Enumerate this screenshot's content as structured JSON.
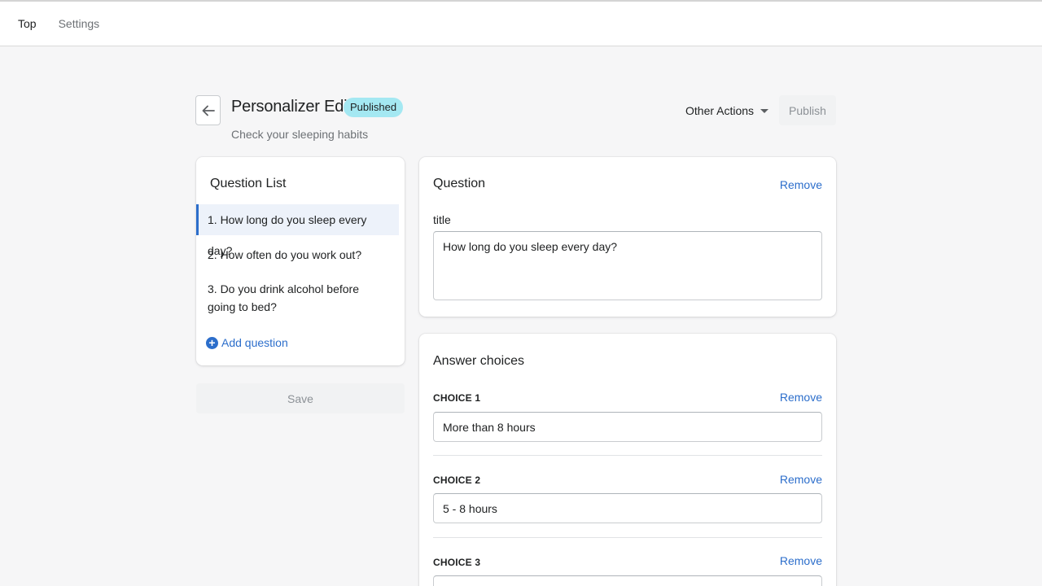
{
  "nav": {
    "items": [
      {
        "label": "Top"
      },
      {
        "label": "Settings"
      }
    ]
  },
  "header": {
    "title": "Personalizer Edit",
    "badge": "Published",
    "subtitle": "Check your sleeping habits",
    "other_actions_label": "Other Actions",
    "publish_label": "Publish"
  },
  "question_list": {
    "title": "Question List",
    "items": [
      {
        "label": "1. How long do you sleep every day?"
      },
      {
        "label": "2. How often do you work out?"
      },
      {
        "label": "3. Do you drink alcohol before going to bed?"
      }
    ],
    "add_label": "Add question",
    "save_label": "Save"
  },
  "question": {
    "title": "Question",
    "remove_label": "Remove",
    "field_label": "title",
    "value": "How long do you sleep every day?"
  },
  "answers": {
    "title": "Answer choices",
    "choices": [
      {
        "label": "CHOICE 1",
        "value": "More than 8 hours",
        "remove_label": "Remove"
      },
      {
        "label": "CHOICE 2",
        "value": "5 - 8 hours",
        "remove_label": "Remove"
      },
      {
        "label": "CHOICE 3",
        "value": "",
        "remove_label": "Remove"
      }
    ]
  },
  "colors": {
    "accent": "#2c6ecb",
    "badge": "#a4e8f2",
    "background": "#f6f6f7"
  }
}
